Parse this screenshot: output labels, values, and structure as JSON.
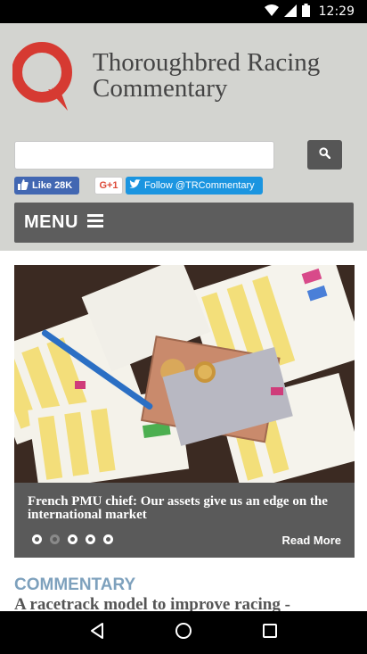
{
  "status_bar": {
    "time": "12:29",
    "icons": [
      "wifi-icon",
      "signal-icon",
      "battery-icon"
    ]
  },
  "header": {
    "site_title_line1": "Thoroughbred Racing",
    "site_title_line2": "Commentary",
    "logo_color": "#d63a32",
    "background": "#d3d4d0"
  },
  "search": {
    "placeholder": "",
    "value": "",
    "button_icon": "search-icon"
  },
  "social": {
    "facebook_label": "Like 28K",
    "gplus_label": "G+1",
    "twitter_label": "Follow @TRCommentary"
  },
  "menu": {
    "label": "MENU",
    "icon": "hamburger-icon"
  },
  "slider": {
    "caption": "French PMU chief: Our assets give us an edge on the international market",
    "read_more": "Read More",
    "dot_count": 5,
    "active_dot": 2
  },
  "section": {
    "heading": "COMMENTARY"
  },
  "article": {
    "title": "A racetrack model to improve racing -"
  },
  "nav": {
    "buttons": [
      "back-icon",
      "home-icon",
      "recents-icon"
    ]
  }
}
